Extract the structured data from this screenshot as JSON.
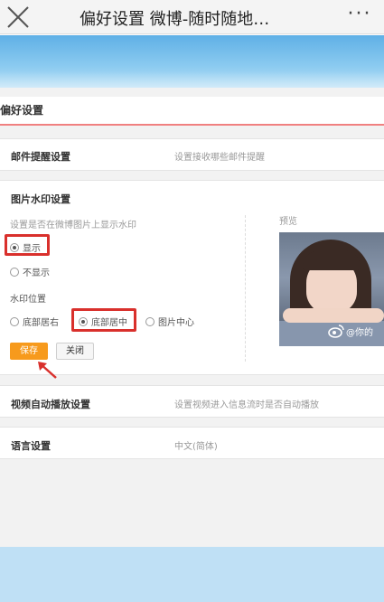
{
  "topbar": {
    "title": "偏好设置 微博-随时随地…",
    "more_label": "···"
  },
  "panel": {
    "title": "偏好设置"
  },
  "mail": {
    "label": "邮件提醒设置",
    "desc": "设置接收哪些邮件提醒"
  },
  "watermark": {
    "label": "图片水印设置",
    "question": "设置是否在微博图片上显示水印",
    "options": [
      "显示",
      "不显示"
    ],
    "selected_option": "显示",
    "position_label": "水印位置",
    "positions": [
      "底部居右",
      "底部居中",
      "图片中心"
    ],
    "selected_position": "底部居中",
    "save_label": "保存",
    "close_label": "关闭",
    "preview_label": "预览",
    "preview_watermark_text": "@你的"
  },
  "video": {
    "label": "视频自动播放设置",
    "desc": "设置视频进入信息流时是否自动播放"
  },
  "language": {
    "label": "语言设置",
    "desc": "中文(简体)"
  },
  "colors": {
    "highlight": "#d9302c",
    "save_button": "#f79a1c",
    "banner": "#5fb0e6"
  }
}
